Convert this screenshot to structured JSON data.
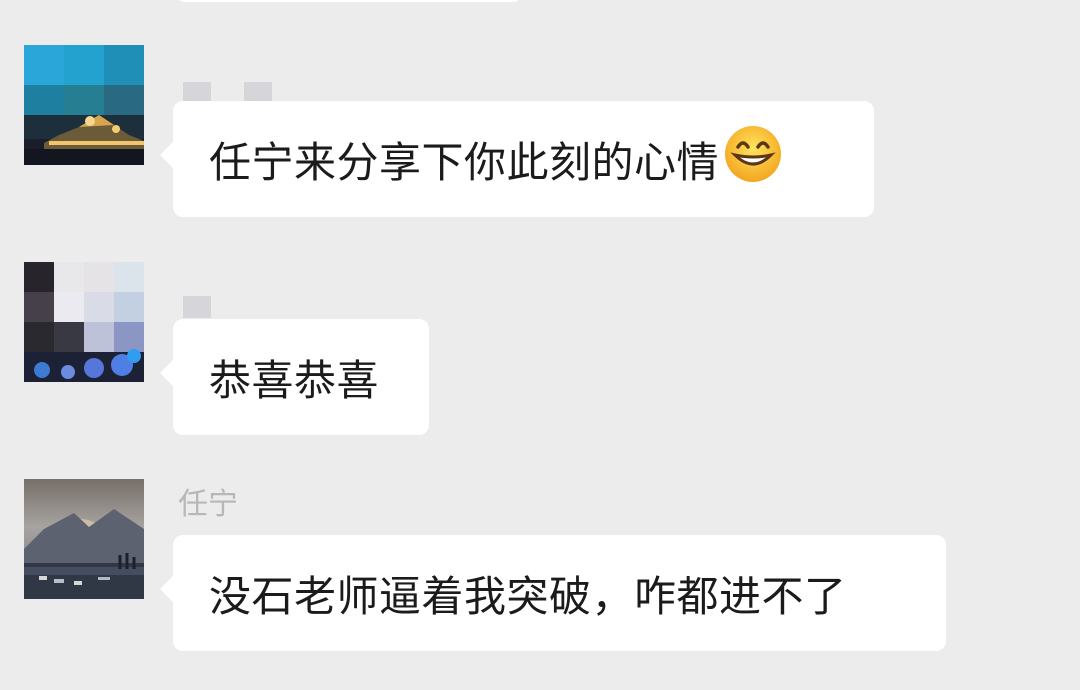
{
  "messages": [
    {
      "sender": "",
      "text": "任宁来分享下你此刻的心情",
      "emoji": "grinning-face-emoji"
    },
    {
      "sender": "",
      "text": "恭喜恭喜",
      "emoji": ""
    },
    {
      "sender": "任宁",
      "text": "没石老师逼着我突破，咋都进不了",
      "emoji": ""
    }
  ],
  "colors": {
    "background": "#ececec",
    "bubble": "#ffffff",
    "text": "#1b1b1b",
    "sender_name": "#b7b7b7"
  }
}
